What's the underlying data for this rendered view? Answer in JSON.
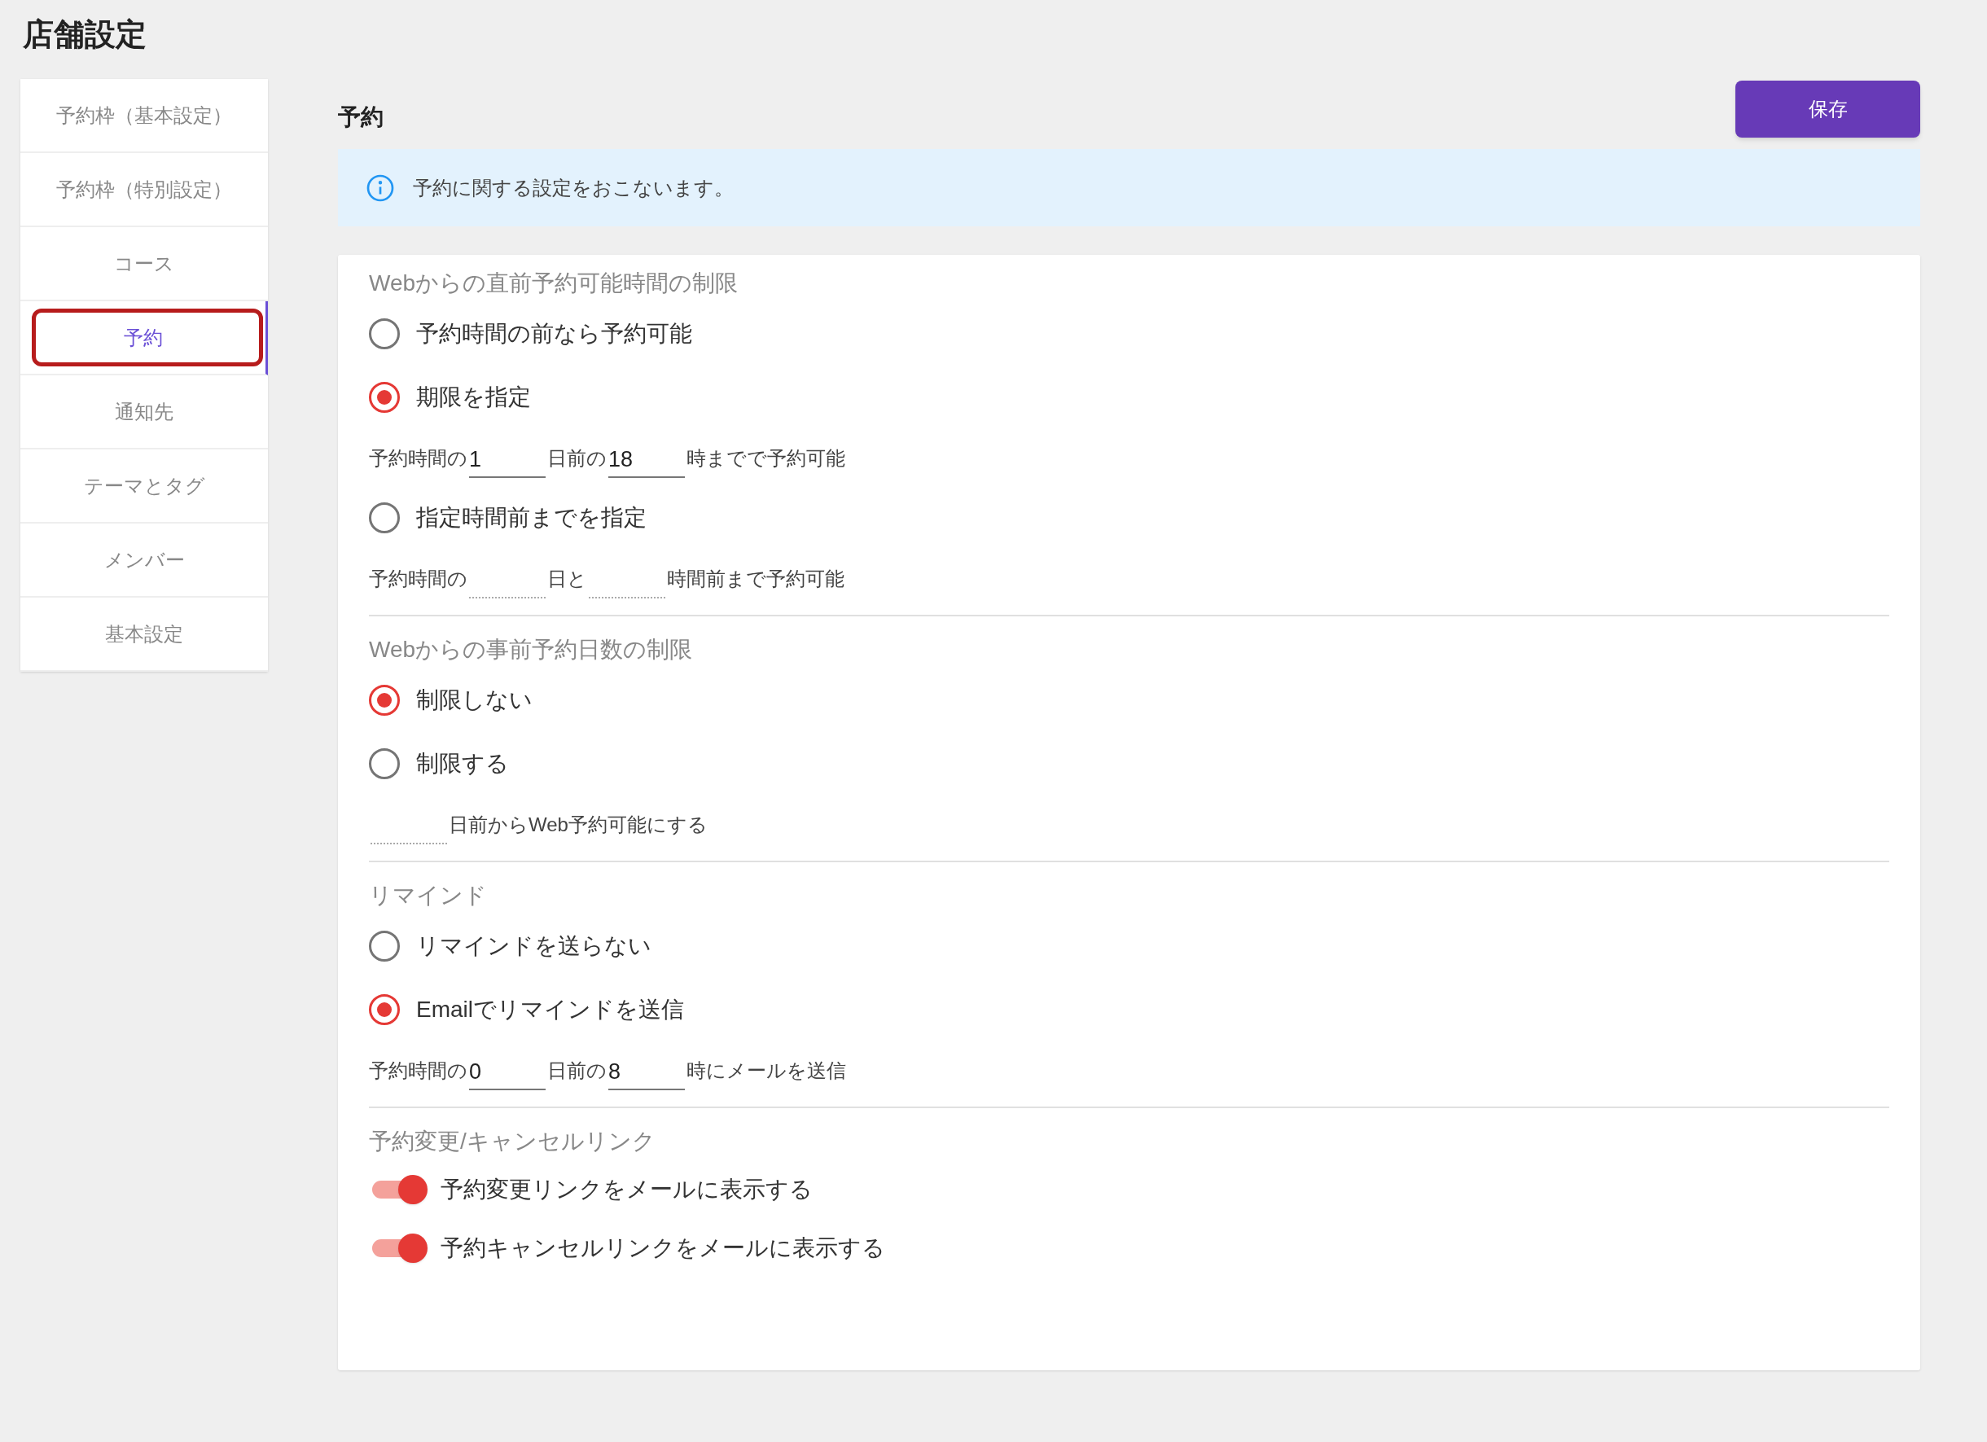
{
  "page_title": "店舗設定",
  "sidebar": {
    "items": [
      {
        "label": "予約枠（基本設定）",
        "selected": false,
        "highlighted": false
      },
      {
        "label": "予約枠（特別設定）",
        "selected": false,
        "highlighted": false
      },
      {
        "label": "コース",
        "selected": false,
        "highlighted": false
      },
      {
        "label": "予約",
        "selected": true,
        "highlighted": true
      },
      {
        "label": "通知先",
        "selected": false,
        "highlighted": false
      },
      {
        "label": "テーマとタグ",
        "selected": false,
        "highlighted": false
      },
      {
        "label": "メンバー",
        "selected": false,
        "highlighted": false
      },
      {
        "label": "基本設定",
        "selected": false,
        "highlighted": false
      }
    ]
  },
  "heading": "予約",
  "save_button": "保存",
  "info_banner": "予約に関する設定をおこないます。",
  "sections": [
    {
      "title": "Webからの直前予約可能時間の制限",
      "items": [
        {
          "kind": "radio",
          "label": "予約時間の前なら予約可能",
          "selected": false
        },
        {
          "kind": "radio",
          "label": "期限を指定",
          "selected": true
        },
        {
          "kind": "inline",
          "parts": [
            {
              "kind": "text",
              "text": "予約時間の"
            },
            {
              "kind": "field",
              "value": "1",
              "disabled": false
            },
            {
              "kind": "text",
              "text": "日前の"
            },
            {
              "kind": "field",
              "value": "18",
              "disabled": false
            },
            {
              "kind": "text",
              "text": "時までで予約可能"
            }
          ]
        },
        {
          "kind": "radio",
          "label": "指定時間前までを指定",
          "selected": false
        },
        {
          "kind": "inline",
          "parts": [
            {
              "kind": "text",
              "text": "予約時間の"
            },
            {
              "kind": "field",
              "disabled": true
            },
            {
              "kind": "text",
              "text": "日と"
            },
            {
              "kind": "field",
              "disabled": true
            },
            {
              "kind": "text",
              "text": "時間前まで予約可能"
            }
          ]
        }
      ]
    },
    {
      "title": "Webからの事前予約日数の制限",
      "items": [
        {
          "kind": "radio",
          "label": "制限しない",
          "selected": true
        },
        {
          "kind": "radio",
          "label": "制限する",
          "selected": false
        },
        {
          "kind": "inline",
          "parts": [
            {
              "kind": "field",
              "disabled": true
            },
            {
              "kind": "text",
              "text": "日前からWeb予約可能にする"
            }
          ]
        }
      ]
    },
    {
      "title": "リマインド",
      "items": [
        {
          "kind": "radio",
          "label": "リマインドを送らない",
          "selected": false
        },
        {
          "kind": "radio",
          "label": "Emailでリマインドを送信",
          "selected": true
        },
        {
          "kind": "inline",
          "parts": [
            {
              "kind": "text",
              "text": "予約時間の"
            },
            {
              "kind": "field",
              "value": "0",
              "disabled": false
            },
            {
              "kind": "text",
              "text": "日前の"
            },
            {
              "kind": "field",
              "value": "8",
              "disabled": false
            },
            {
              "kind": "text",
              "text": "時にメールを送信"
            }
          ]
        }
      ]
    },
    {
      "title": "予約変更/キャンセルリンク",
      "items": [
        {
          "kind": "switch",
          "label": "予約変更リンクをメールに表示する",
          "on": true
        },
        {
          "kind": "switch",
          "label": "予約キャンセルリンクをメールに表示する",
          "on": true
        }
      ]
    }
  ]
}
